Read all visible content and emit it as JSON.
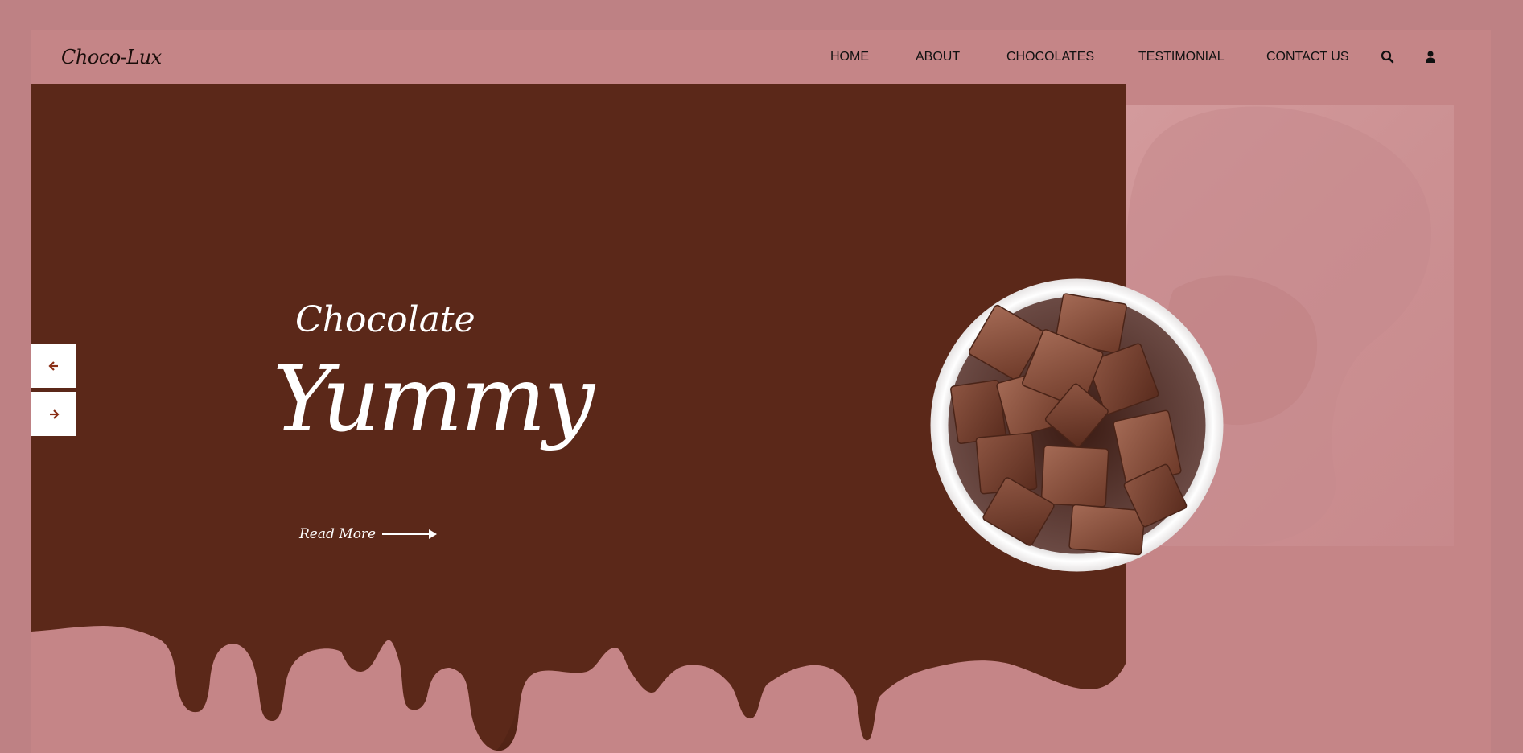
{
  "header": {
    "logo": "Choco-Lux",
    "nav": [
      {
        "label": "HOME"
      },
      {
        "label": "ABOUT"
      },
      {
        "label": "CHOCOLATES"
      },
      {
        "label": "TESTIMONIAL"
      },
      {
        "label": "CONTACT US"
      }
    ],
    "icons": [
      "search-icon",
      "user-icon"
    ]
  },
  "hero": {
    "subtitle": "Chocolate",
    "title": "Yummy",
    "read_more": "Read More",
    "prev_icon": "arrow-left-icon",
    "next_icon": "arrow-right-icon"
  },
  "colors": {
    "page_background": "#c58587",
    "outer_background": "#be8184",
    "chocolate": "#5b2819",
    "arrow_accent": "#8a2e15",
    "text_light": "#ffffff"
  }
}
